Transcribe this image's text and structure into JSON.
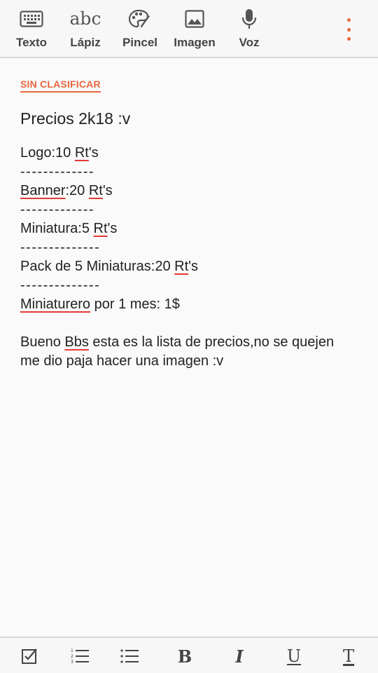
{
  "toolbar": {
    "tools": [
      {
        "label": "Texto",
        "icon": "keyboard-icon"
      },
      {
        "label": "Lápiz",
        "icon": "handwriting-icon",
        "glyph": "abc"
      },
      {
        "label": "Pincel",
        "icon": "palette-icon"
      },
      {
        "label": "Imagen",
        "icon": "image-icon"
      },
      {
        "label": "Voz",
        "icon": "microphone-icon"
      }
    ],
    "more_icon": "more-vertical-icon",
    "accent_color": "#e8663d"
  },
  "note": {
    "category": "SIN CLASIFICAR",
    "title": "Precios 2k18 :v",
    "lines": {
      "logo_prefix": "Logo:10 ",
      "logo_rt": "Rt",
      "logo_suffix": "'s",
      "sep1": "-------------",
      "banner_word": "Banner",
      "banner_mid": ":20 ",
      "banner_rt": "Rt",
      "banner_suffix": "'s",
      "sep2": "-------------",
      "mini_prefix": "Miniatura:5 ",
      "mini_rt": "Rt",
      "mini_suffix": "'s",
      "sep3": "--------------",
      "pack_prefix": "Pack de 5 Miniaturas:20 ",
      "pack_rt": "Rt",
      "pack_suffix": "'s",
      "sep4": "--------------",
      "miniaturero_word": "Miniaturero",
      "miniaturero_suffix": " por 1 mes: 1$",
      "para_prefix": "Bueno ",
      "para_word": "Bbs",
      "para_suffix": " esta es la lista de precios,no se quejen me dio paja hacer una imagen :v"
    },
    "spellcheck_color": "#e53935"
  },
  "format_bar": {
    "buttons": [
      "checkbox-icon",
      "numbered-list-icon",
      "bullet-list-icon",
      "bold-icon",
      "italic-icon",
      "underline-icon",
      "text-style-icon"
    ],
    "bold_glyph": "B",
    "italic_glyph": "I",
    "underline_glyph": "U",
    "text_glyph": "T"
  }
}
